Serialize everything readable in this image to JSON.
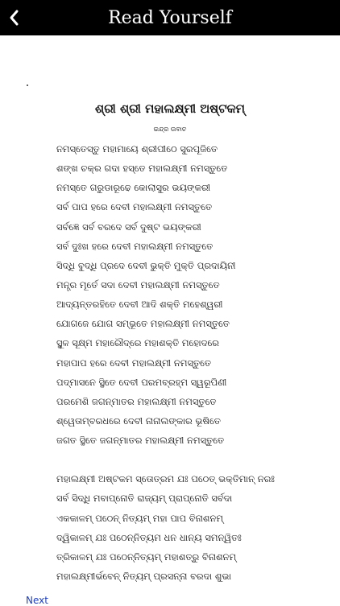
{
  "header": {
    "title": "Read Yourself",
    "back_icon": "chevron-left-icon"
  },
  "content": {
    "heading": "ଶ୍ରୀ ଶ୍ରୀ ମହାଲକ୍ଷ୍ମୀ ଅଷ୍ଟକମ୍",
    "subheading": "ଇନ୍ଦ୍ର ଉବାଚ",
    "stanza1": [
      "ନମସ୍ତେସ୍ତୁ ମହାମାୟେ ଶ୍ରୀପୀଠେ ସୁରପୂଜିତେ",
      "ଶଙ୍ଖ ଚକ୍ର ଗଦା ହସ୍ତେ ମହାଲକ୍ଷ୍ମୀ ନମସ୍ତୁତେ",
      "ନମସ୍ତେ ଗରୁଡାରୂଢେ କୋଲାସୁର ଭୟଙ୍କରୀ",
      "ସର୍ବ ପାପ ହରେ ଦେବୀ ମହାଲକ୍ଷ୍ମୀ ନମସ୍ତୁତେ",
      "ସର୍ବଜ୍ଞେ ସର୍ବ ବରଦେ ସର୍ବ ଦୁଷ୍ଟ ଭୟଙ୍କରୀ",
      "ସର୍ବ ଦୁଃଖ ହରେ ଦେବୀ ମହାଲକ୍ଷ୍ମୀ ନମସ୍ତୁତେ",
      "ସିଦ୍ଧି ବୁଦ୍ଧି ପ୍ରଦେ ଦେବୀ ଭୁକ୍ତି ମୁକ୍ତି ପ୍ରଦାୟିନୀ",
      "ମନ୍ତ୍ର ମୂର୍ତେ ସଦା ଦେବୀ ମହାଲକ୍ଷ୍ମୀ ନମସ୍ତୁତେ",
      "ଆଦ୍ୟନ୍ତରହିତେ ଦେବୀ ଆଦି ଶକ୍ତି ମହେଶ୍ୱରୀ",
      "ଯୋଗଜେ ଯୋଗ ସମ୍ଭୂତେ ମହାଲକ୍ଷ୍ମୀ ନମସ୍ତୁତେ",
      "ସ୍ଥୂଳ ସୂକ୍ଷ୍ମ ମହାରୌଦ୍ରେ ମହାଶକ୍ତି ମହୋଦରେ",
      "ମହାପାପ ହରେ ଦେବୀ ମହାଲକ୍ଷ୍ମୀ ନମସ୍ତୁତେ",
      "ପଦ୍ମାସନେ ସ୍ଥିତେ ଦେବୀ ପରମବ୍ରହ୍ମ ସ୍ୱରୂପିଣୀ",
      "ପରମେଶି ଜଗନ୍ମାତର ମହାଲକ୍ଷ୍ମୀ ନମସ୍ତୁତେ",
      "ଶ୍ୱେତାମ୍ବରଧରେ ଦେବୀ ନାନାଲଙ୍କାର ଭୂଷିତେ",
      "ଜଗତ ସ୍ଥିତେ ଜଗନ୍ମାତର ମହାଲକ୍ଷ୍ମୀ ନମସ୍ତୁତେ"
    ],
    "stanza2": [
      "ମହାଲକ୍ଷ୍ମୀ ଅଷ୍ଟକମ ସ୍ତୋତ୍ରମ ଯଃ ପଠେତ୍ ଭକ୍ତିମାନ୍ ନରଃ",
      "ସର୍ବ ସିଦ୍ଧି ମବାପ୍ନୋତି ରାଜ୍ୟମ୍ ପ୍ରାପ୍ନୋତି ସର୍ବଦା",
      "ଏକକାଳମ୍ ପଠେନ୍ ନିତ୍ୟମ୍ ମହା ପାପ ବିନାଶନମ୍",
      "ଦ୍ୱିକାଳମ୍ ଯଃ ପଠେନ୍ନିତ୍ୟମ ଧନ ଧାନ୍ୟ ସମନ୍ୱିତଃ",
      "ତ୍ରିକାଳମ୍ ଯଃ ପଠେନ୍ନିତ୍ୟମ୍ ମହାଶତ୍ରୁ ବିନାଶନମ୍",
      "ମହାଲକ୍ଷ୍ମୀର୍ଭବେନ୍ ନିତ୍ୟମ୍ ପ୍ରସନ୍ନା ବରଦା ଶୁଭା"
    ]
  },
  "footer": {
    "next_label": "Next"
  },
  "colors": {
    "header_bg": "#000000",
    "header_text": "#ffffff",
    "link": "#1e3fbf"
  }
}
